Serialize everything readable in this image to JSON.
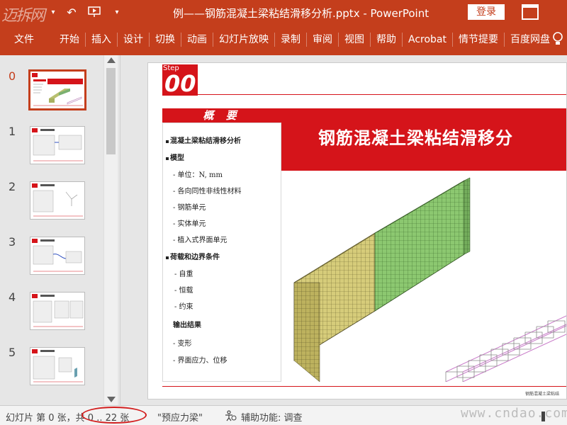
{
  "window": {
    "title": "例——钢筋混凝土梁粘结滑移分析.pptx - PowerPoint",
    "login_label": "登录",
    "logo_text": "迈拆网",
    "quick_access": [
      "save-icon",
      "undo-icon",
      "redo-icon",
      "present-icon",
      "customize-icon"
    ]
  },
  "ribbon": {
    "tabs": [
      "文件",
      "开始",
      "插入",
      "设计",
      "切换",
      "动画",
      "幻灯片放映",
      "录制",
      "审阅",
      "视图",
      "帮助",
      "Acrobat",
      "情节提要",
      "百度网盘"
    ],
    "accent": "#c43e1c"
  },
  "thumbnails": {
    "numbers": [
      "0",
      "1",
      "2",
      "3",
      "4",
      "5"
    ],
    "selected": "0"
  },
  "slide": {
    "step_label": "Step",
    "step_number": "00",
    "overview_title": "概 要",
    "main_title": "钢筋混凝土梁粘结滑移分",
    "items": [
      "混凝土梁粘结滑移分析",
      "模型",
      "- 单位：N, mm",
      "- 各向同性非线性材料",
      "- 钢筋单元",
      "- 实体单元",
      "- 植入式界面单元",
      "荷载和边界条件",
      "- 自重",
      "- 恒载",
      "- 约束",
      "输出结果",
      "- 变形",
      "- 界面应力、位移"
    ],
    "footer": "钢筋混凝土梁粘结",
    "brand_red": "#d5141a"
  },
  "status": {
    "slide_info": "幻灯片 第 0 张，共 0 .. 22 张",
    "theme": "\"预应力梁\"",
    "accessibility": "辅助功能: 调查",
    "watermark": "www.cndao.com"
  }
}
